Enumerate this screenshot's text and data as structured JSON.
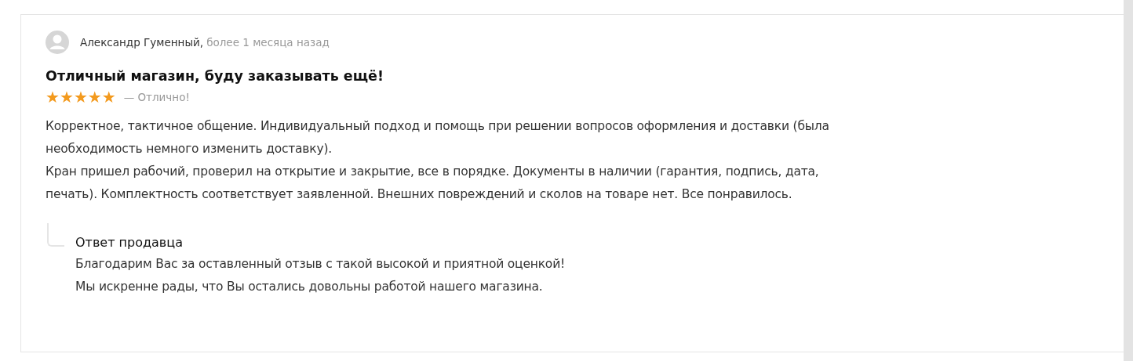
{
  "review": {
    "author": "Александр Гуменный,",
    "time": "более 1 месяца назад",
    "title": "Отличный магазин, буду заказывать ещё!",
    "stars": 5,
    "rating_label": "— Отлично!",
    "paragraphs": [
      "Корректное, тактичное общение. Индивидуальный подход и помощь при решении вопросов оформления и доставки (была необходимость немного изменить доставку).",
      "Кран пришел рабочий, проверил на открытие и закрытие, все в порядке. Документы в наличии (гарантия, подпись, дата, печать). Комплектность соответствует заявленной. Внешних повреждений и сколов на товаре нет. Все понравилось."
    ],
    "reply": {
      "title": "Ответ продавца",
      "lines": [
        "Благодарим Вас за оставленный отзыв с такой высокой и приятной оценкой!",
        "Мы искренне рады, что Вы остались довольны работой нашего магазина."
      ]
    }
  }
}
